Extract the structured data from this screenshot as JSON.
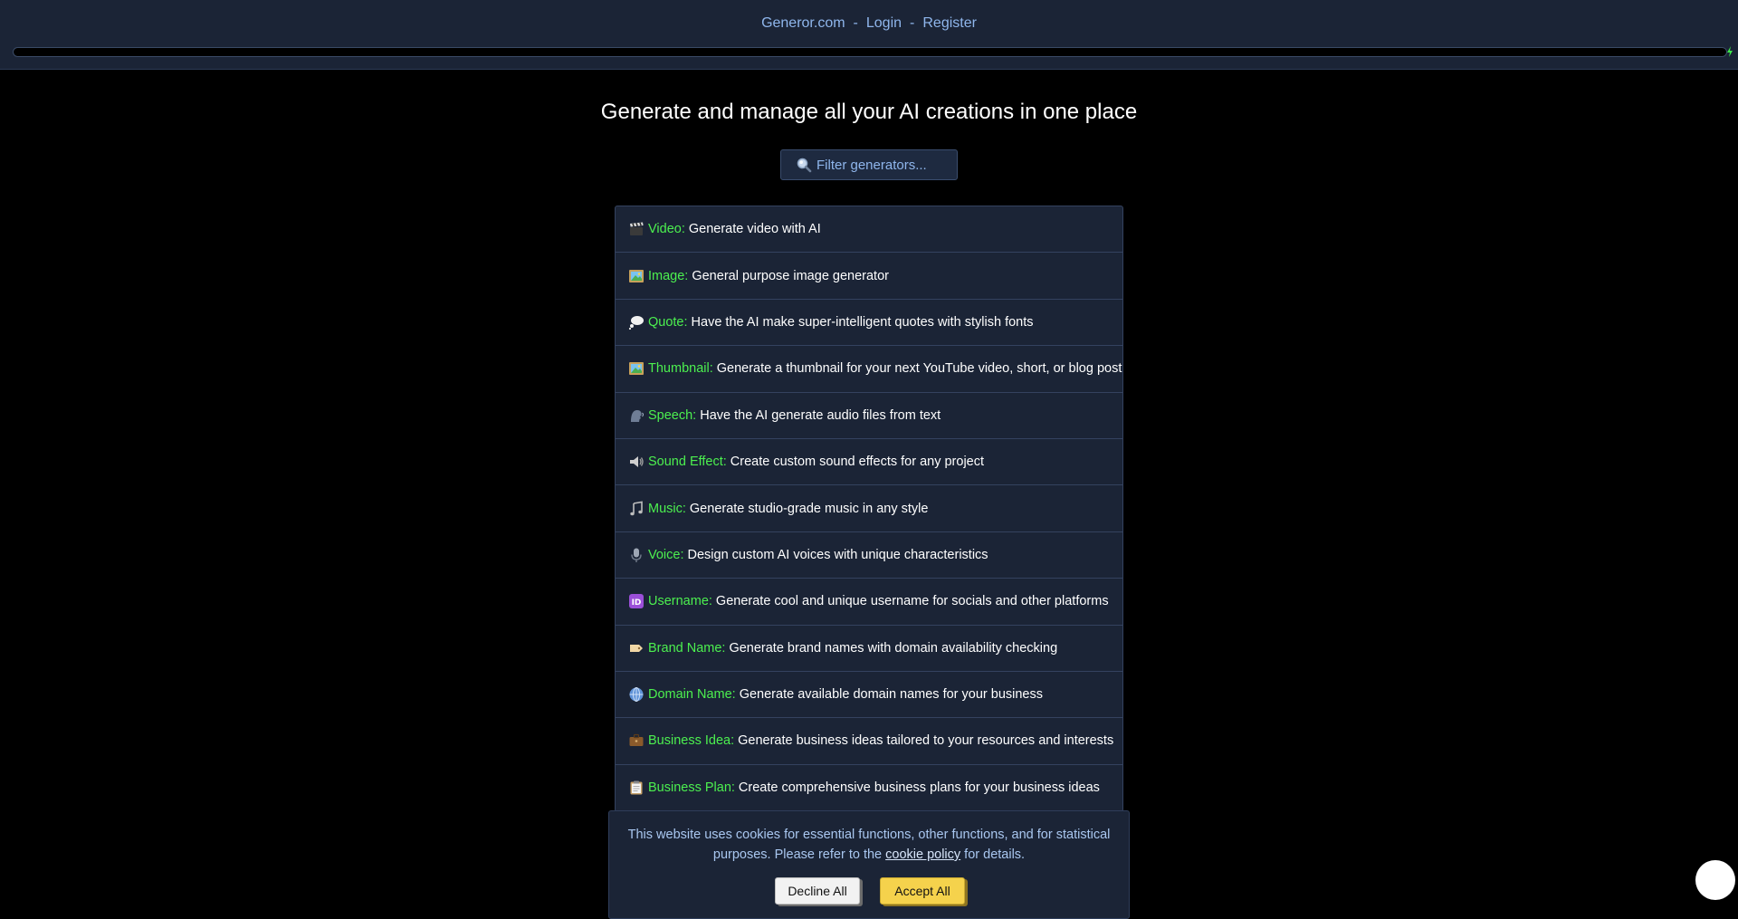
{
  "nav": {
    "site": "Generor.com",
    "sep1": "-",
    "login": "Login",
    "sep2": "-",
    "register": "Register"
  },
  "headline": "Generate and manage all your AI creations in one place",
  "search": {
    "placeholder": "Filter generators...",
    "icon": "magnifier-icon"
  },
  "generators": [
    {
      "icon": "clapper-icon",
      "name": "Video:",
      "desc": "Generate video with AI"
    },
    {
      "icon": "framed-picture-icon",
      "name": "Image:",
      "desc": "General purpose image generator"
    },
    {
      "icon": "thought-bubble-icon",
      "name": "Quote:",
      "desc": "Have the AI make super-intelligent quotes with stylish fonts"
    },
    {
      "icon": "framed-picture-icon",
      "name": "Thumbnail:",
      "desc": "Generate a thumbnail for your next YouTube video, short, or blog post"
    },
    {
      "icon": "speaking-head-icon",
      "name": "Speech:",
      "desc": "Have the AI generate audio files from text"
    },
    {
      "icon": "speaker-icon",
      "name": "Sound Effect:",
      "desc": "Create custom sound effects for any project"
    },
    {
      "icon": "music-notes-icon",
      "name": "Music:",
      "desc": "Generate studio-grade music in any style"
    },
    {
      "icon": "microphone-icon",
      "name": "Voice:",
      "desc": "Design custom AI voices with unique characteristics"
    },
    {
      "icon": "id-badge-icon",
      "name": "Username:",
      "desc": "Generate cool and unique username for socials and other platforms"
    },
    {
      "icon": "label-tag-icon",
      "name": "Brand Name:",
      "desc": "Generate brand names with domain availability checking"
    },
    {
      "icon": "globe-icon",
      "name": "Domain Name:",
      "desc": "Generate available domain names for your business"
    },
    {
      "icon": "briefcase-icon",
      "name": "Business Idea:",
      "desc": "Generate business ideas tailored to your resources and interests"
    },
    {
      "icon": "clipboard-icon",
      "name": "Business Plan:",
      "desc": "Create comprehensive business plans for your business ideas"
    }
  ],
  "cookie": {
    "text_before": "This website uses cookies for essential functions, other functions, and for statistical purposes. Please refer to the ",
    "link": "cookie policy",
    "text_after": " for details.",
    "decline": "Decline All",
    "accept": "Accept All"
  },
  "colors": {
    "background": "#000000",
    "panel": "#1b2436",
    "accent_green": "#4cf04f",
    "link_blue": "#8fb6ec",
    "accept_yellow": "#f5d24c"
  }
}
